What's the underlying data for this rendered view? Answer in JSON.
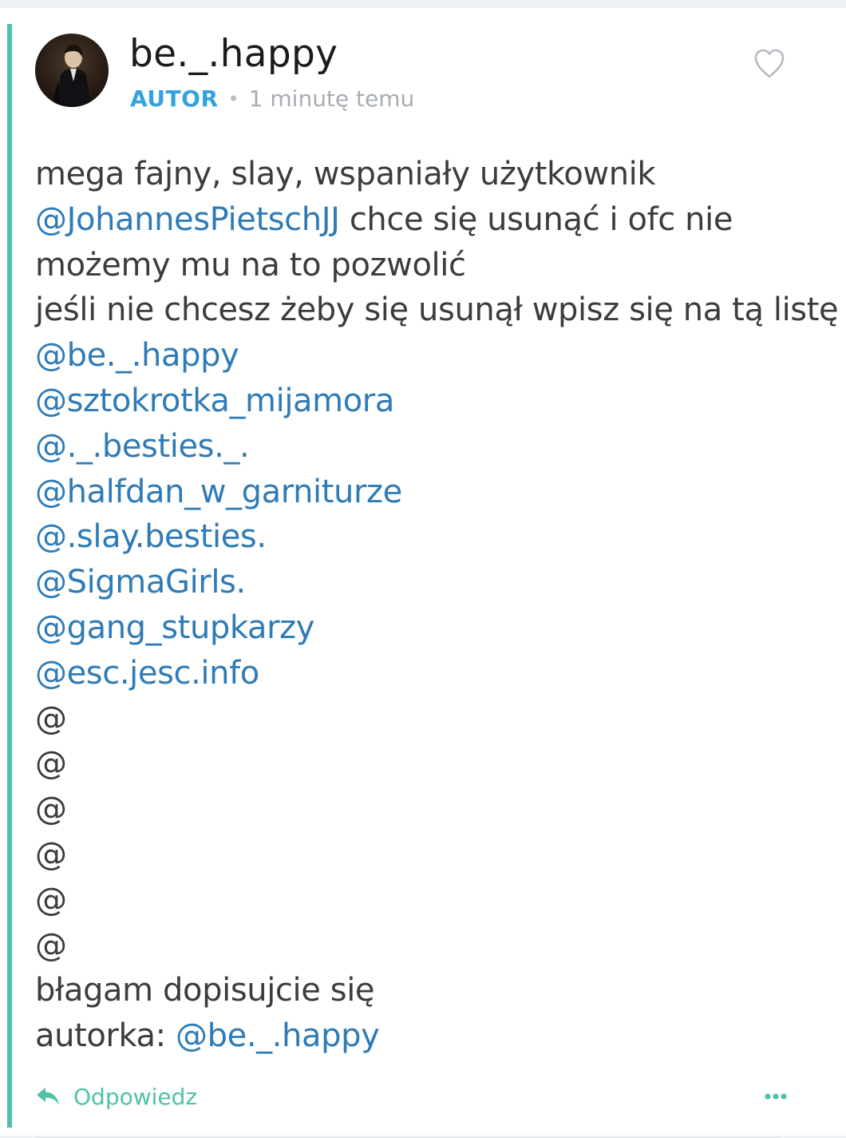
{
  "comment": {
    "username": "be._.happy",
    "badge": "AUTOR",
    "separator": "•",
    "timestamp": "1 minutę temu",
    "lines": [
      [
        {
          "text": "mega fajny, slay, wspaniały użytkownik",
          "mention": false
        }
      ],
      [
        {
          "text": "@JohannesPietschJJ",
          "mention": true
        },
        {
          "text": " chce się usunąć i ofc nie",
          "mention": false
        }
      ],
      [
        {
          "text": "możemy mu na to pozwolić",
          "mention": false
        }
      ],
      [
        {
          "text": "jeśli nie chcesz żeby się usunął wpisz się na tą listę",
          "mention": false
        }
      ],
      [
        {
          "text": "@be._.happy",
          "mention": true
        }
      ],
      [
        {
          "text": "@sztokrotka_mijamora",
          "mention": true
        }
      ],
      [
        {
          "text": "@._.besties._.",
          "mention": true
        }
      ],
      [
        {
          "text": "@halfdan_w_garniturze",
          "mention": true
        }
      ],
      [
        {
          "text": "@.slay.besties.",
          "mention": true
        }
      ],
      [
        {
          "text": "@SigmaGirls.",
          "mention": true
        }
      ],
      [
        {
          "text": "@gang_stupkarzy",
          "mention": true
        }
      ],
      [
        {
          "text": "@esc.jesc.info",
          "mention": true
        }
      ],
      [
        {
          "text": "@",
          "mention": false
        }
      ],
      [
        {
          "text": "@",
          "mention": false
        }
      ],
      [
        {
          "text": "@",
          "mention": false
        }
      ],
      [
        {
          "text": "@",
          "mention": false
        }
      ],
      [
        {
          "text": "@",
          "mention": false
        }
      ],
      [
        {
          "text": "@",
          "mention": false
        }
      ],
      [
        {
          "text": "błagam dopisujcie się",
          "mention": false
        }
      ],
      [
        {
          "text": "autorka: ",
          "mention": false
        },
        {
          "text": "@be._.happy",
          "mention": true
        }
      ]
    ],
    "reply_label": "Odpowiedz",
    "icons": {
      "like": "heart-outline-icon",
      "reply": "reply-arrow-icon",
      "more": "more-dots-icon"
    }
  },
  "colors": {
    "accent": "#4fc1a6",
    "badge": "#33a3dc",
    "mention": "#2f7bb6",
    "text": "#3c3c3c",
    "muted": "#a8adb3"
  }
}
